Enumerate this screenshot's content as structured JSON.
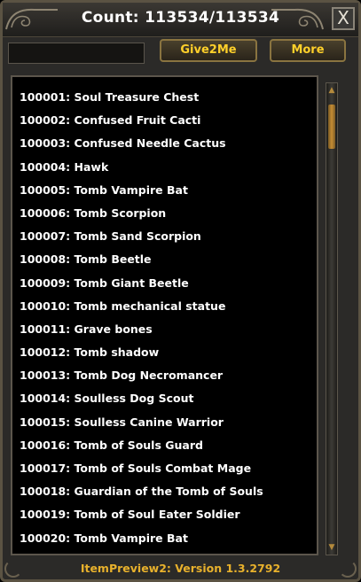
{
  "window": {
    "title": "Count: 113534/113534",
    "close_label": "X"
  },
  "toolbar": {
    "search_value": "",
    "give_label": "Give2Me",
    "more_label": "More"
  },
  "items": [
    "100001: Soul Treasure Chest",
    "100002: Confused Fruit Cacti",
    "100003: Confused Needle Cactus",
    "100004: Hawk",
    "100005: Tomb Vampire Bat",
    "100006: Tomb Scorpion",
    "100007: Tomb Sand Scorpion",
    "100008: Tomb Beetle",
    "100009: Tomb Giant Beetle",
    "100010: Tomb mechanical statue",
    "100011: Grave bones",
    "100012: Tomb shadow",
    "100013: Tomb Dog Necromancer",
    "100014: Soulless Dog Scout",
    "100015: Soulless Canine Warrior",
    "100016: Tomb of Souls Guard",
    "100017: Tomb of Souls Combat Mage",
    "100018: Guardian of the Tomb of Souls",
    "100019: Tomb of Soul Eater Soldier",
    "100020: Tomb Vampire Bat"
  ],
  "footer": {
    "version": "ItemPreview2: Version 1.3.2792"
  },
  "colors": {
    "button_text": "#ffd02a",
    "footer_text": "#e8b12c",
    "list_background": "#000000",
    "frame": "#2b2a28"
  },
  "icons": {
    "close": "close-icon",
    "scroll_up": "scroll-up-arrow-icon",
    "scroll_down": "scroll-down-arrow-icon"
  }
}
